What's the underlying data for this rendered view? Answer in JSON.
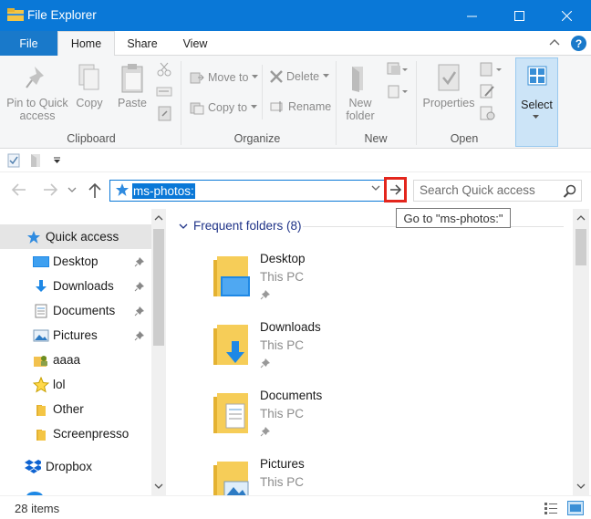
{
  "window": {
    "title": "File Explorer"
  },
  "ribbon_tabs": {
    "file": "File",
    "home": "Home",
    "share": "Share",
    "view": "View",
    "help": "?"
  },
  "ribbon": {
    "pin_to_quick_access": "Pin to Quick access",
    "copy": "Copy",
    "paste": "Paste",
    "clipboard_group": "Clipboard",
    "move_to": "Move to",
    "copy_to": "Copy to",
    "delete": "Delete",
    "rename": "Rename",
    "organize_group": "Organize",
    "new_folder": "New folder",
    "new_group": "New",
    "properties": "Properties",
    "open_group": "Open",
    "select": "Select"
  },
  "address": {
    "value": "ms-photos:"
  },
  "go_tooltip": "Go to \"ms-photos:\"",
  "search": {
    "placeholder": "Search Quick access"
  },
  "nav_pane": {
    "items": [
      {
        "label": "Quick access",
        "icon": "star-icon",
        "pinned": false
      },
      {
        "label": "Desktop",
        "icon": "desktop-icon",
        "pinned": true
      },
      {
        "label": "Downloads",
        "icon": "download-icon",
        "pinned": true
      },
      {
        "label": "Documents",
        "icon": "documents-icon",
        "pinned": true
      },
      {
        "label": "Pictures",
        "icon": "pictures-icon",
        "pinned": true
      },
      {
        "label": "aaaa",
        "icon": "user-folder-icon",
        "pinned": false
      },
      {
        "label": "lol",
        "icon": "star-icon",
        "pinned": false
      },
      {
        "label": "Other",
        "icon": "folder-icon",
        "pinned": false
      },
      {
        "label": "Screenpresso",
        "icon": "folder-icon",
        "pinned": false
      },
      {
        "label": "Dropbox",
        "icon": "dropbox-icon",
        "pinned": false
      }
    ]
  },
  "content": {
    "group_header": "Frequent folders (8)",
    "folders": [
      {
        "name": "Desktop",
        "location": "This PC"
      },
      {
        "name": "Downloads",
        "location": "This PC"
      },
      {
        "name": "Documents",
        "location": "This PC"
      },
      {
        "name": "Pictures",
        "location": "This PC"
      }
    ]
  },
  "status": {
    "item_count": "28 items"
  },
  "colors": {
    "accent": "#0a78d7",
    "highlight_frame": "#e3261d",
    "selection": "#cce4f7"
  }
}
